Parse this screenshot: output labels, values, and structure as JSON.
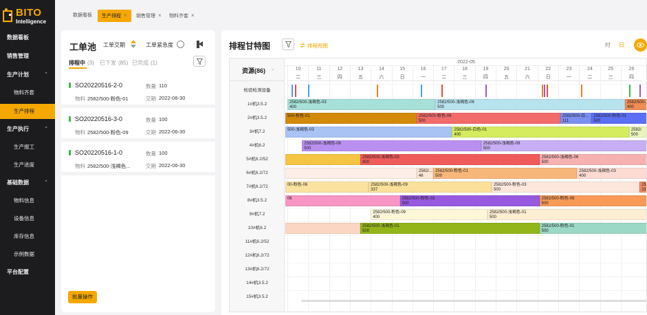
{
  "brand": {
    "name": "BITO",
    "tagline": "Intelligence",
    "color": "#f5a800"
  },
  "sidebar": {
    "items": [
      {
        "label": "数据看板",
        "level": 0
      },
      {
        "label": "销售管理",
        "level": 0
      },
      {
        "label": "生产计划",
        "level": 0,
        "expanded": true
      },
      {
        "label": "物料齐套",
        "level": 1
      },
      {
        "label": "生产排程",
        "level": 1,
        "active": true
      },
      {
        "label": "生产执行",
        "level": 0,
        "expanded": true
      },
      {
        "label": "生产报工",
        "level": 1
      },
      {
        "label": "生产进度",
        "level": 1
      },
      {
        "label": "基础数据",
        "level": 0,
        "expanded": true
      },
      {
        "label": "物料信息",
        "level": 1
      },
      {
        "label": "设备信息",
        "level": 1
      },
      {
        "label": "库存信息",
        "level": 1
      },
      {
        "label": "示例数据",
        "level": 1
      },
      {
        "label": "平台配置",
        "level": 0
      }
    ]
  },
  "tabs": [
    {
      "label": "数据看板",
      "closable": false
    },
    {
      "label": "生产排程",
      "closable": true,
      "active": true
    },
    {
      "label": "销售管理",
      "closable": true
    },
    {
      "label": "物料齐套",
      "closable": true
    }
  ],
  "pool": {
    "title": "工单池",
    "sort_label": "工单交期",
    "urgency_label": "工单紧急度",
    "subtabs": [
      {
        "label": "排程中",
        "count": "(3)",
        "active": true
      },
      {
        "label": "已下发",
        "count": "(85)"
      },
      {
        "label": "已完成",
        "count": "(1)"
      }
    ],
    "labels": {
      "qty": "数量",
      "material": "物料",
      "due": "交期"
    },
    "orders": [
      {
        "code": "SO20220516-2-0",
        "qty": "110",
        "material": "2582/500-粉色-01",
        "due": "2022-06-30"
      },
      {
        "code": "SO20220516-3-0",
        "qty": "100",
        "material": "2582/500-粉色-09",
        "due": "2022-06-30"
      },
      {
        "code": "SO20220516-1-0",
        "qty": "100",
        "material": "2582/500-浅褐色...",
        "due": "2022-06-30"
      }
    ],
    "batch_label": "批量操作"
  },
  "gantt": {
    "title": "排程甘特图",
    "view_label": "排程视图",
    "units": [
      {
        "label": "时"
      },
      {
        "label": "日",
        "active": true
      }
    ],
    "resource_header": "资源(86)",
    "month": "2022-05",
    "days": [
      {
        "d": "10",
        "w": "二"
      },
      {
        "d": "11",
        "w": "三"
      },
      {
        "d": "12",
        "w": "四"
      },
      {
        "d": "13",
        "w": "五"
      },
      {
        "d": "14",
        "w": "六"
      },
      {
        "d": "15",
        "w": "日"
      },
      {
        "d": "16",
        "w": "一"
      },
      {
        "d": "17",
        "w": "二"
      },
      {
        "d": "18",
        "w": "三"
      },
      {
        "d": "19",
        "w": "四"
      },
      {
        "d": "20",
        "w": "五"
      },
      {
        "d": "21",
        "w": "六"
      },
      {
        "d": "22",
        "w": "日"
      },
      {
        "d": "23",
        "w": "一"
      },
      {
        "d": "24",
        "w": "二"
      },
      {
        "d": "25",
        "w": "三"
      },
      {
        "d": "26",
        "w": "四"
      }
    ],
    "resources": [
      "检验检测设备",
      "1#机3.5.2",
      "2#机3.5.2",
      "3#机7.2",
      "4#机6.2",
      "5#机6.2/52",
      "6#机6.2/72",
      "7#机6.2/72",
      "8#机3.5.2",
      "9#机7.2",
      "10#机6.2",
      "11#机6.2/52",
      "12#机6.2/72",
      "13#机6.2/72",
      "14#机3.5.2",
      "15#机3.5.2"
    ],
    "inspection_ticks": [
      {
        "day": 0.2,
        "color": "#3aa0ff"
      },
      {
        "day": 0.35,
        "color": "#e64c3c"
      },
      {
        "day": 1.0,
        "color": "#3aa0ff"
      },
      {
        "day": 4.3,
        "color": "#e67e22"
      },
      {
        "day": 6.4,
        "color": "#3aa0ff"
      },
      {
        "day": 7.4,
        "color": "#e64c3c"
      },
      {
        "day": 9.5,
        "color": "#9b59b6"
      },
      {
        "day": 12.2,
        "color": "#e67e22"
      },
      {
        "day": 12.3,
        "color": "#9b59b6"
      },
      {
        "day": 12.45,
        "color": "#e64c3c"
      },
      {
        "day": 14.1,
        "color": "#e67e22"
      },
      {
        "day": 16.4,
        "color": "#3bb54a"
      },
      {
        "day": 16.9,
        "color": "#9b59b6"
      }
    ],
    "tasks": [
      {
        "row": 1,
        "start": 0,
        "end": 7.1,
        "color": "#a7e0d8",
        "label": "2582/500-浅褐色-03",
        "qty": "400"
      },
      {
        "row": 1,
        "start": 7.1,
        "end": 16.2,
        "color": "#b7e3ef",
        "label": "2582/500-浅褐色-06",
        "qty": "500"
      },
      {
        "row": 1,
        "start": 16.2,
        "end": 17.5,
        "color": "#f08c55",
        "label": "2582/500-浅",
        "qty": "400"
      },
      {
        "row": 2,
        "start": -0.1,
        "end": 6.2,
        "color": "#d3890a",
        "label": "500-粉色-01",
        "qty": ""
      },
      {
        "row": 2,
        "start": 6.2,
        "end": 13.1,
        "color": "#f26b6b",
        "label": "2582/500-粉色-06",
        "qty": "500"
      },
      {
        "row": 2,
        "start": 13.1,
        "end": 14.6,
        "color": "#7a8ff0",
        "label": "2582/500-白...",
        "qty": "111"
      },
      {
        "row": 2,
        "start": 14.6,
        "end": 17.5,
        "color": "#5b6ff5",
        "label": "2582/500-粉色-01",
        "qty": "500"
      },
      {
        "row": 3,
        "start": -0.1,
        "end": 7.9,
        "color": "#a9c3f5",
        "label": "500-浅褐色-03",
        "qty": ""
      },
      {
        "row": 3,
        "start": 7.9,
        "end": 16.4,
        "color": "#d4ec5e",
        "label": "2582/500-白色-01",
        "qty": "400"
      },
      {
        "row": 3,
        "start": 16.4,
        "end": 17.5,
        "color": "#eaf5b9",
        "label": "2582/",
        "qty": "500"
      },
      {
        "row": 4,
        "start": 0.7,
        "end": 9.3,
        "color": "#b98ff0",
        "label": "2582/500-浅褐色-06",
        "qty": "500"
      },
      {
        "row": 4,
        "start": 9.3,
        "end": 17.5,
        "color": "#c8aef5",
        "label": "2582/500-浅褐色-09",
        "qty": "500"
      },
      {
        "row": 5,
        "start": -0.1,
        "end": 3.5,
        "color": "#f5c442",
        "label": "",
        "qty": ""
      },
      {
        "row": 5,
        "start": 3.5,
        "end": 12.1,
        "color": "#ef5b5b",
        "label": "2582/500-浅褐色-03",
        "qty": "400"
      },
      {
        "row": 5,
        "start": 12.1,
        "end": 17.5,
        "color": "#f6b1b1",
        "label": "2582/500-浅褐色-06",
        "qty": "500"
      },
      {
        "row": 6,
        "start": -0.1,
        "end": 6.2,
        "color": "#fdeee8",
        "label": "",
        "qty": ""
      },
      {
        "row": 6,
        "start": 6.2,
        "end": 7.0,
        "color": "#fde5d6",
        "label": "2582/...",
        "qty": "46"
      },
      {
        "row": 6,
        "start": 7.0,
        "end": 13.9,
        "color": "#f8b77a",
        "label": "2582/500-粉色-01",
        "qty": "500"
      },
      {
        "row": 6,
        "start": 13.9,
        "end": 17.5,
        "color": "#fddbd3",
        "label": "2582/500-浅褐色-03",
        "qty": "400"
      },
      {
        "row": 7,
        "start": -0.1,
        "end": 3.9,
        "color": "#fbe2a0",
        "label": "00-粉色-06",
        "qty": ""
      },
      {
        "row": 7,
        "start": 3.9,
        "end": 9.8,
        "color": "#fae09a",
        "label": "2582/500-浅褐色-09",
        "qty": "337"
      },
      {
        "row": 7,
        "start": 9.8,
        "end": 16.9,
        "color": "#fde7dc",
        "label": "2582/500-粉色-03",
        "qty": "500"
      },
      {
        "row": 7,
        "start": 16.9,
        "end": 17.5,
        "color": "#f08a5d",
        "label": "2582",
        "qty": "332"
      },
      {
        "row": 8,
        "start": -0.1,
        "end": 5.4,
        "color": "#f796c4",
        "label": "06",
        "qty": ""
      },
      {
        "row": 8,
        "start": 5.4,
        "end": 12.1,
        "color": "#9659e0",
        "label": "2582/500-粉色-03",
        "qty": "500"
      },
      {
        "row": 8,
        "start": 12.1,
        "end": 17.5,
        "color": "#f79a58",
        "label": "2582/500-粉色-06",
        "qty": "500"
      },
      {
        "row": 9,
        "start": 4.0,
        "end": 9.6,
        "color": "#fdf6d8",
        "label": "2582/500-粉色-09",
        "qty": "400"
      },
      {
        "row": 9,
        "start": 9.6,
        "end": 17.5,
        "color": "#fdedd2",
        "label": "2582/500-浅褐色-01",
        "qty": "500"
      },
      {
        "row": 10,
        "start": -0.1,
        "end": 3.5,
        "color": "#fbd7c3",
        "label": "",
        "qty": ""
      },
      {
        "row": 10,
        "start": 3.5,
        "end": 12.1,
        "color": "#94b51a",
        "label": "2582/500-浅褐色-01",
        "qty": "500"
      },
      {
        "row": 10,
        "start": 12.1,
        "end": 17.5,
        "color": "#9bd8c5",
        "label": "2582/500-粉色-01",
        "qty": "500"
      }
    ]
  }
}
